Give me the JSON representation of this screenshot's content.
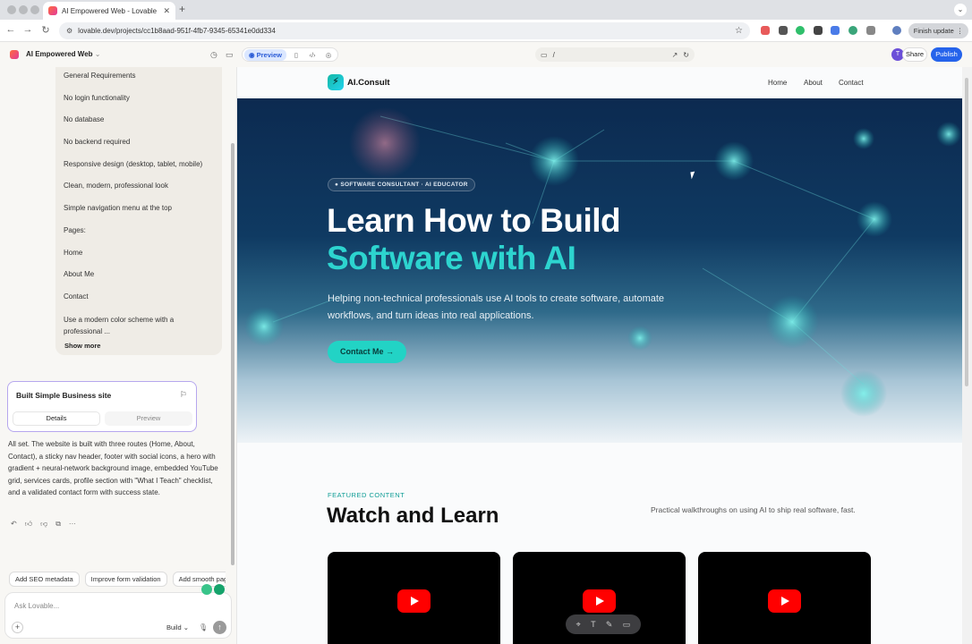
{
  "browser": {
    "tab_title": "AI Empowered Web - Lovable",
    "url": "lovable.dev/projects/cc1b8aad-951f-4fb7-9345-65341e0dd334",
    "finish_update": "Finish update"
  },
  "lovable": {
    "project_name": "AI Empowered Web",
    "preview_label": "Preview",
    "path": "/",
    "avatar_initial": "T",
    "share": "Share",
    "publish": "Publish"
  },
  "chat": {
    "requirements": [
      "General Requirements",
      "No login functionality",
      "No database",
      "No backend required",
      "Responsive design (desktop, tablet, mobile)",
      "Clean, modern, professional look",
      "Simple navigation menu at the top",
      "Pages:",
      "Home",
      "About Me",
      "Contact",
      "Use a modern color scheme with a professional ..."
    ],
    "show_more": "Show more",
    "card_title": "Built Simple Business site",
    "card_tab_details": "Details",
    "card_tab_preview": "Preview",
    "message": "All set. The website is built with three routes (Home, About, Contact), a sticky nav header, footer with social icons, a hero with gradient + neural-network background image, embedded YouTube grid, services cards, profile section with \"What I Teach\" checklist, and a validated contact form with success state.",
    "suggestions": [
      "Add SEO metadata",
      "Improve form validation",
      "Add smooth page"
    ],
    "placeholder": "Ask Lovable...",
    "mode": "Build"
  },
  "site": {
    "brand": "AI.Consult",
    "nav": [
      "Home",
      "About",
      "Contact"
    ],
    "badge": "SOFTWARE CONSULTANT · AI EDUCATOR",
    "headline_1": "Learn How to Build",
    "headline_2": "Software with AI",
    "lead": "Helping non-technical professionals use AI tools to create software, automate workflows, and turn ideas into real applications.",
    "cta": "Contact Me",
    "featured_label": "FEATURED CONTENT",
    "section_title": "Watch and Learn",
    "section_sub": "Practical walkthroughs on using AI to ship real software, fast."
  },
  "colors": {
    "accent": "#22d3c5",
    "headline_accent": "#2dd4cf",
    "publish": "#2563eb",
    "youtube": "#ff0000"
  }
}
